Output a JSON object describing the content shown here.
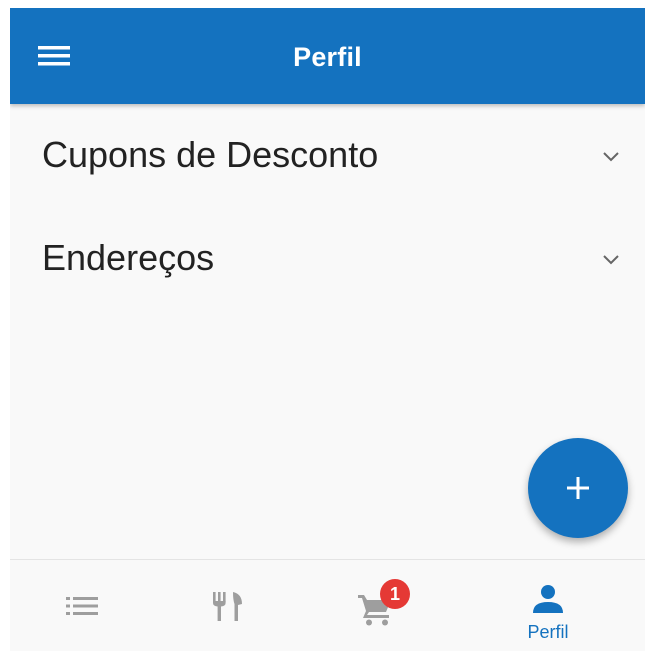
{
  "header": {
    "title": "Perfil",
    "menu_icon": "hamburger-menu-icon",
    "background": "#1472bf"
  },
  "sections": [
    {
      "label": "Cupons de Desconto",
      "icon": "chevron-down-icon"
    },
    {
      "label": "Endereços",
      "icon": "chevron-down-icon"
    }
  ],
  "fab": {
    "icon": "plus-icon"
  },
  "bottom_nav": {
    "items": [
      {
        "icon": "list-icon",
        "label": "",
        "active": false
      },
      {
        "icon": "fork-knife-icon",
        "label": "",
        "active": false
      },
      {
        "icon": "cart-icon",
        "label": "",
        "active": false,
        "badge": "1"
      },
      {
        "icon": "person-icon",
        "label": "Perfil",
        "active": true
      }
    ],
    "active_color": "#1472bf",
    "inactive_color": "#9e9e9e",
    "badge_color": "#e53935"
  }
}
